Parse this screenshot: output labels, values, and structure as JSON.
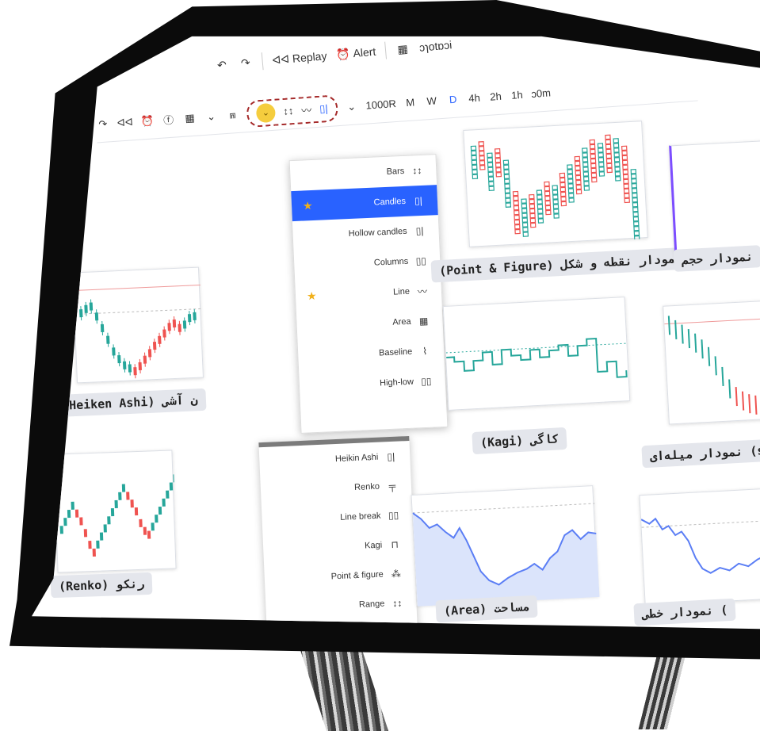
{
  "topbar": {
    "undo_icon": "undo-icon",
    "redo_icon": "redo-icon",
    "replay_label": "ᐊᐊ Replay",
    "alert_label": "Alert",
    "indicators_label": "ɔɿotɒɔi"
  },
  "toolbar": {
    "timeframes": [
      "ɔ0m",
      "1h",
      "2h",
      "4h",
      "D",
      "W",
      "M",
      "1000R"
    ],
    "active_timeframe": "D",
    "dropdown_caret": "⌄",
    "replay_icon": "ᐊᐊ"
  },
  "chart_type_menu": {
    "items": [
      {
        "label": "Bars",
        "icon": "↕↕",
        "active": false,
        "star": false
      },
      {
        "label": "Candles",
        "icon": "▯|",
        "active": true,
        "star": true
      },
      {
        "label": "Hollow candles",
        "icon": "▯|",
        "active": false,
        "star": false
      },
      {
        "label": "Columns",
        "icon": "▯▯",
        "active": false,
        "star": false
      },
      {
        "label": "Line",
        "icon": "〰",
        "active": false,
        "star": true
      },
      {
        "label": "Area",
        "icon": "▦",
        "active": false,
        "star": false
      },
      {
        "label": "Baseline",
        "icon": "⌇",
        "active": false,
        "star": false
      },
      {
        "label": "High-low",
        "icon": "▯▯",
        "active": false,
        "star": false
      }
    ],
    "items2": [
      {
        "label": "Heikin Ashi",
        "icon": "▯|"
      },
      {
        "label": "Renko",
        "icon": "╤"
      },
      {
        "label": "Line break",
        "icon": "▯▯"
      },
      {
        "label": "Kagi",
        "icon": "⊓"
      },
      {
        "label": "Point & figure",
        "icon": "⁂"
      },
      {
        "label": "Range",
        "icon": "↕↕"
      }
    ]
  },
  "captions": {
    "point_figure": "(Point & Figure) نمودار نقطه و شکل",
    "heiken": "(Heiken Ashi) ن آشی",
    "kagi": "(Kagi) کاگی",
    "renko": "(Renko) رنکو",
    "area": "(Area) مساحت",
    "line_partial": "نمودار خطی (",
    "volume_partial": "نمودار حجم",
    "bars_partial": "نمودار میله‌ای (s"
  },
  "colors": {
    "accent": "#2962ff",
    "up": "#26a69a",
    "down": "#ef5350",
    "highlight": "#f5cd3e",
    "dashed": "#a52a2a"
  }
}
